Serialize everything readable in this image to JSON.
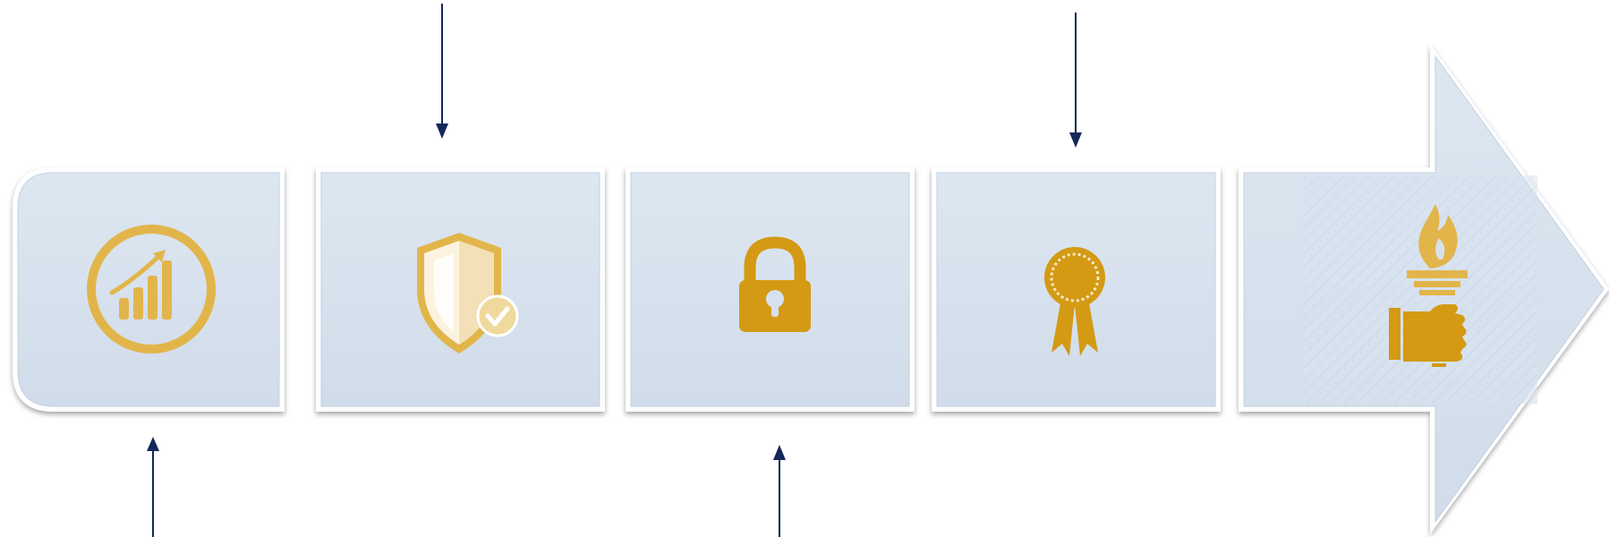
{
  "diagram": {
    "steps": [
      {
        "id": "growth",
        "icon": "growth-chart-icon"
      },
      {
        "id": "protection",
        "icon": "shield-check-icon"
      },
      {
        "id": "security",
        "icon": "padlock-icon"
      },
      {
        "id": "quality",
        "icon": "award-ribbon-icon"
      },
      {
        "id": "leadership",
        "icon": "torch-hand-icon"
      }
    ],
    "arrows": [
      {
        "target": "growth",
        "direction": "up"
      },
      {
        "target": "protection",
        "direction": "down"
      },
      {
        "target": "security",
        "direction": "up"
      },
      {
        "target": "quality",
        "direction": "down"
      }
    ]
  },
  "colors": {
    "panel_fill": "#d6e1ed",
    "panel_border": "#ffffff",
    "icon_gold": "#e2b54b",
    "icon_gold_dark": "#d49a14",
    "icon_cream": "#f5e4bd",
    "arrow_line": "#14285a"
  }
}
